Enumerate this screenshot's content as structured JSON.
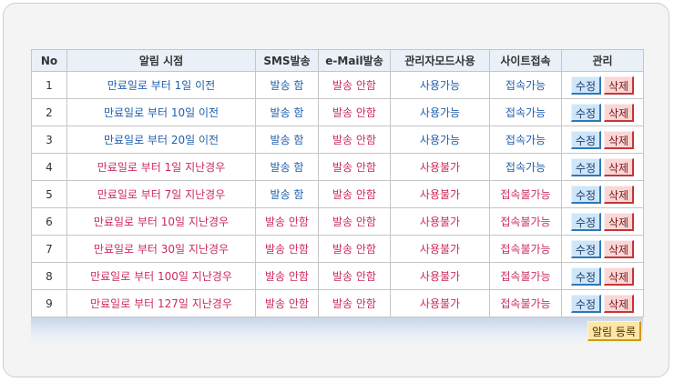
{
  "colors": {
    "link_blue": "#1f5fae",
    "alert_red": "#cc2b5b",
    "header_bg": "#e9f0f8",
    "edit_button_bg": "#cfe6f8",
    "delete_button_bg": "#fad7d7",
    "register_button_bg": "#fde6a6"
  },
  "table": {
    "headers": [
      "No",
      "알림 시점",
      "SMS발송",
      "e-Mail발송",
      "관리자모드사용",
      "사이트접속",
      "관리"
    ],
    "rows": [
      {
        "no": "1",
        "title": "만료일로 부터 1일 이전",
        "title_color": "blue",
        "sms": "발송 함",
        "sms_color": "blue",
        "email": "발송 안함",
        "email_color": "red",
        "admin": "사용가능",
        "admin_color": "blue",
        "site": "접속가능",
        "site_color": "blue"
      },
      {
        "no": "2",
        "title": "만료일로 부터 10일 이전",
        "title_color": "blue",
        "sms": "발송 함",
        "sms_color": "blue",
        "email": "발송 안함",
        "email_color": "red",
        "admin": "사용가능",
        "admin_color": "blue",
        "site": "접속가능",
        "site_color": "blue"
      },
      {
        "no": "3",
        "title": "만료일로 부터 20일 이전",
        "title_color": "blue",
        "sms": "발송 함",
        "sms_color": "blue",
        "email": "발송 안함",
        "email_color": "red",
        "admin": "사용가능",
        "admin_color": "blue",
        "site": "접속가능",
        "site_color": "blue"
      },
      {
        "no": "4",
        "title": "만료일로 부터 1일 지난경우",
        "title_color": "red",
        "sms": "발송 함",
        "sms_color": "blue",
        "email": "발송 안함",
        "email_color": "red",
        "admin": "사용불가",
        "admin_color": "red",
        "site": "접속가능",
        "site_color": "blue"
      },
      {
        "no": "5",
        "title": "만료일로 부터 7일 지난경우",
        "title_color": "red",
        "sms": "발송 함",
        "sms_color": "blue",
        "email": "발송 안함",
        "email_color": "red",
        "admin": "사용불가",
        "admin_color": "red",
        "site": "접속불가능",
        "site_color": "red"
      },
      {
        "no": "6",
        "title": "만료일로 부터 10일 지난경우",
        "title_color": "red",
        "sms": "발송 안함",
        "sms_color": "red",
        "email": "발송 안함",
        "email_color": "red",
        "admin": "사용불가",
        "admin_color": "red",
        "site": "접속불가능",
        "site_color": "red"
      },
      {
        "no": "7",
        "title": "만료일로 부터 30일 지난경우",
        "title_color": "red",
        "sms": "발송 안함",
        "sms_color": "red",
        "email": "발송 안함",
        "email_color": "red",
        "admin": "사용불가",
        "admin_color": "red",
        "site": "접속불가능",
        "site_color": "red"
      },
      {
        "no": "8",
        "title": "만료일로 부터 100일 지난경우",
        "title_color": "red",
        "sms": "발송 안함",
        "sms_color": "red",
        "email": "발송 안함",
        "email_color": "red",
        "admin": "사용불가",
        "admin_color": "red",
        "site": "접속불가능",
        "site_color": "red"
      },
      {
        "no": "9",
        "title": "만료일로 부터 127일 지난경우",
        "title_color": "red",
        "sms": "발송 안함",
        "sms_color": "red",
        "email": "발송 안함",
        "email_color": "red",
        "admin": "사용불가",
        "admin_color": "red",
        "site": "접속불가능",
        "site_color": "red"
      }
    ]
  },
  "actions": {
    "edit_label": "수정",
    "delete_label": "삭제",
    "register_label": "알림 등록"
  }
}
